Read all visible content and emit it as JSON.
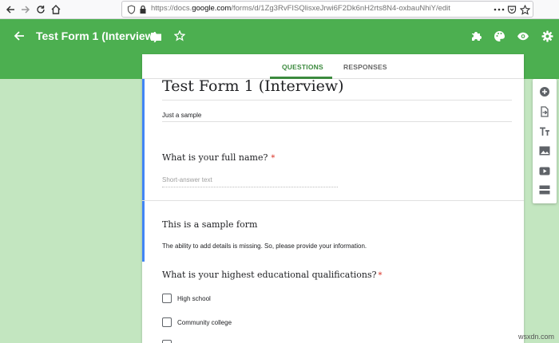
{
  "browser": {
    "url_prefix": "https://docs.",
    "url_domain": "google.com",
    "url_path": "/forms/d/1Zg3RvFISQlisxeJrwi6F2Dk6nH2rts8N4-oxbauNhiY/edit",
    "icons": [
      "back-icon",
      "forward-icon",
      "reload-icon",
      "home-icon",
      "shield-icon",
      "lock-icon",
      "more-icon",
      "star-icon"
    ]
  },
  "appbar": {
    "title": "Test Form 1 (Interview)",
    "color": "#4caf50",
    "icons": [
      "back-arrow-icon",
      "folder-icon",
      "star-icon",
      "addon-puzzle-icon",
      "palette-icon",
      "preview-eye-icon",
      "settings-gear-icon"
    ]
  },
  "tabs": {
    "questions": "QUESTIONS",
    "responses": "RESPONSES",
    "active": "questions",
    "accent": "#3c8a3e"
  },
  "form": {
    "title": "Test Form 1 (Interview)",
    "description": "Just a sample",
    "question1": {
      "label": "What is your full name?",
      "required_mark": "*",
      "placeholder": "Short-answer text"
    },
    "section": {
      "title": "This is a sample form",
      "description": "The ability to add details is missing. So, please provide your information."
    },
    "question2": {
      "label": "What is your highest educational qualifications?",
      "required_mark": "*",
      "options": [
        "High school",
        "Community college"
      ]
    }
  },
  "toolbar": {
    "icons": [
      "add-question-icon",
      "import-questions-icon",
      "add-title-icon",
      "add-image-icon",
      "add-video-icon",
      "add-section-icon"
    ]
  },
  "watermark": "wsxdn.com"
}
